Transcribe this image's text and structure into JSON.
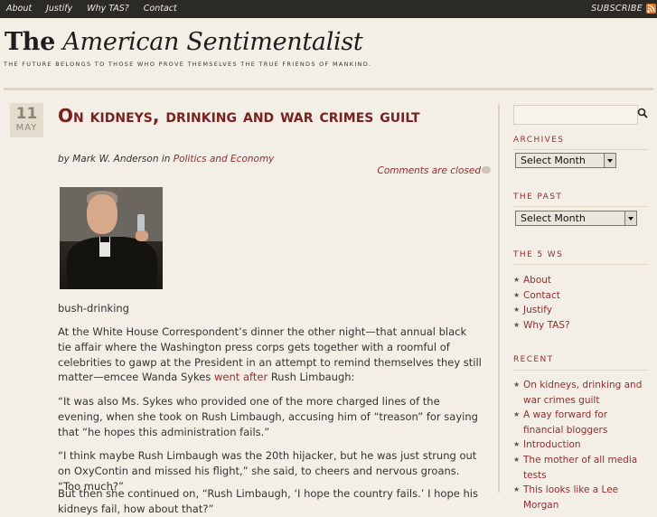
{
  "topnav": {
    "links": [
      "About",
      "Justify",
      "Why TAS?",
      "Contact"
    ],
    "subscribe": "SUBSCRIBE",
    "rss_icon": "rss-icon"
  },
  "site": {
    "title_the": "The",
    "title_name": "American Sentimentalist",
    "tagline": "The future belongs to those who prove themselves the true friends of mankind."
  },
  "post": {
    "day": "11",
    "month": "MAY",
    "title": "On kidneys, drinking and war crimes guilt",
    "byline_prefix": "by Mark W. Anderson in",
    "category": "Politics and Economy",
    "comments": "Comments are closed",
    "image_caption": "bush-drinking",
    "p1_a": "At the White House Correspondent’s dinner the other night—that annual black tie affair where the Washington press corps gets together with a roomful of celebrities to gawp at the President in an attempt to remind themselves they still matter—emcee Wanda Sykes ",
    "p1_link": "went after",
    "p1_b": " Rush Limbaugh:",
    "p2": "“It was also Ms. Sykes who provided one of the more charged lines of the evening, when she took on Rush Limbaugh, accusing him of “treason” for saying that “he hopes this administration fails.”",
    "p3": "“I think maybe Rush Limbaugh was the 20th hijacker, but he was just strung out on OxyContin and missed his flight,” she said, to cheers and nervous groans. “Too much?”",
    "p4": "But then she continued on, “Rush Limbaugh, ‘I hope the country fails.’ I hope his kidneys fail, how about that?”"
  },
  "sidebar": {
    "search_placeholder": "",
    "archives_heading": "Archives",
    "archives_select": "Select Month",
    "past_heading": "The Past",
    "past_select": "Select Month",
    "ws_heading": "The 5 Ws",
    "ws_items": [
      "About",
      "Contact",
      "Justify",
      "Why TAS?"
    ],
    "recent_heading": "Recent",
    "recent_items": [
      "On kidneys, drinking and war crimes guilt",
      "A way forward for financial bloggers",
      "Introduction",
      "The mother of all media tests",
      "This looks like a Lee Morgan"
    ]
  },
  "colors": {
    "accent": "#8e2f2f",
    "topbar": "#2b2a26",
    "background": "#f3efe6"
  }
}
